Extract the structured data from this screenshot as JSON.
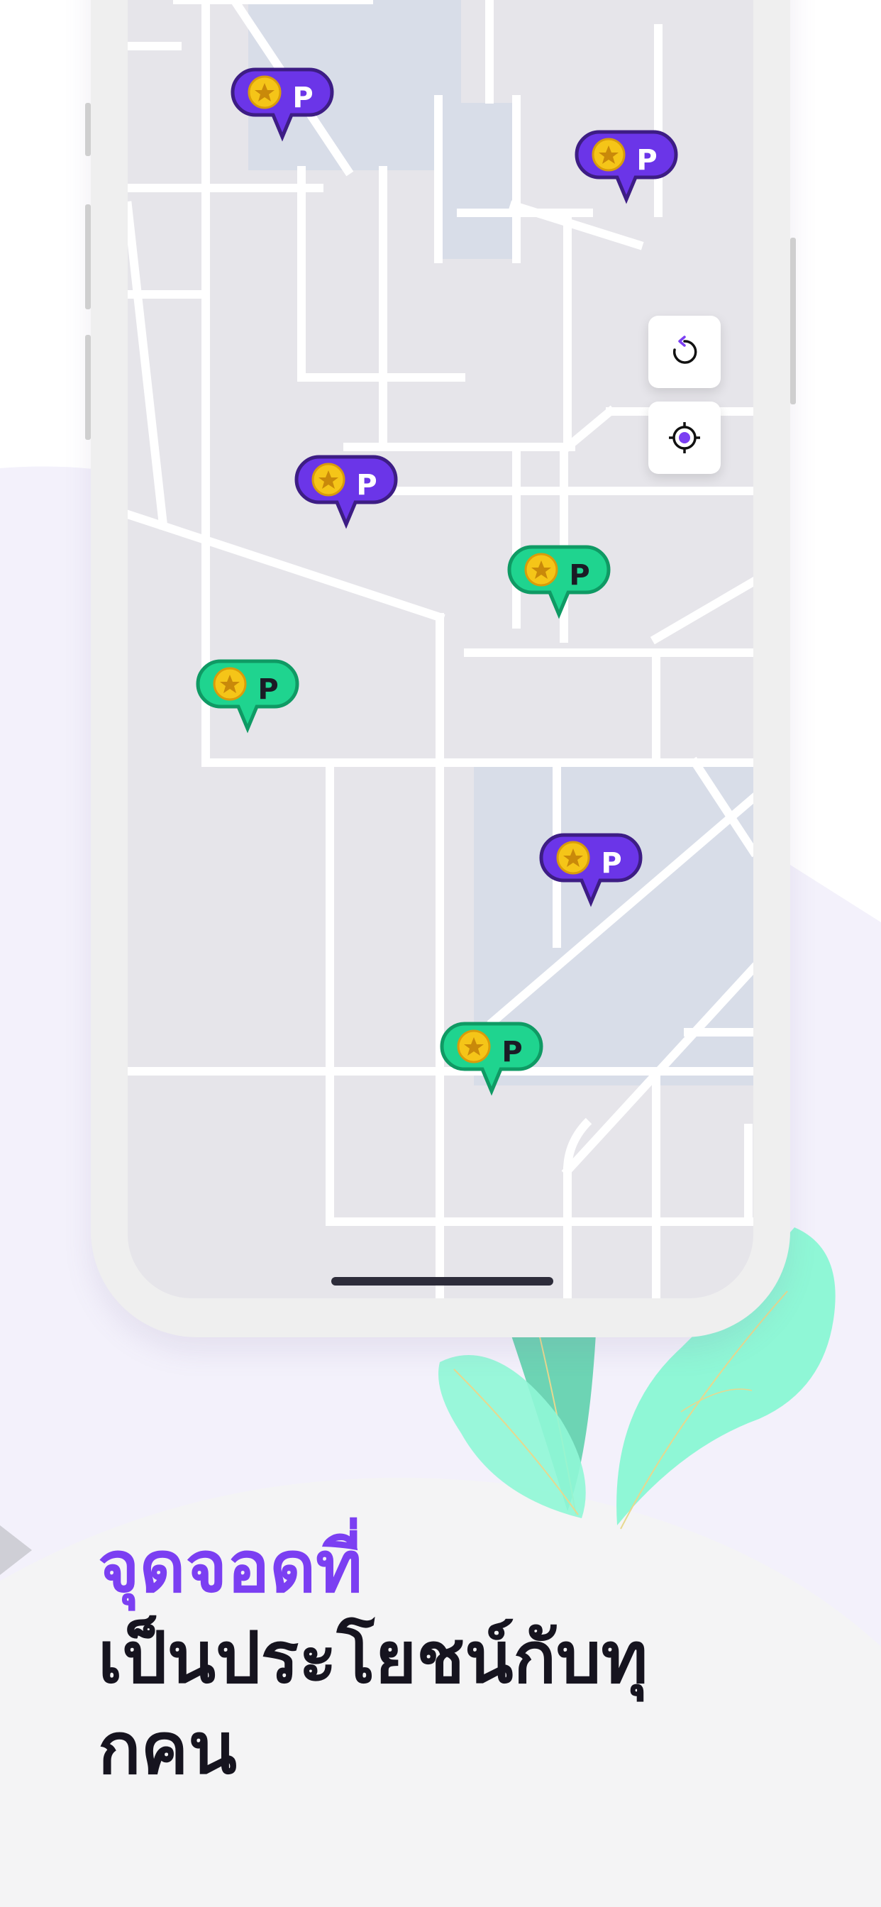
{
  "headline": {
    "line1": "จุดจอดที่",
    "line2": "เป็นประโยชน์กับทุ",
    "line3": "กคน"
  },
  "map": {
    "controls": [
      {
        "icon": "refresh-icon"
      },
      {
        "icon": "my-location-icon"
      }
    ],
    "pins": [
      {
        "letter": "P",
        "style": "purple",
        "icon": "coin-star-icon"
      },
      {
        "letter": "P",
        "style": "purple",
        "icon": "coin-star-icon"
      },
      {
        "letter": "P",
        "style": "purple",
        "icon": "coin-star-icon"
      },
      {
        "letter": "P",
        "style": "green",
        "icon": "coin-star-icon"
      },
      {
        "letter": "P",
        "style": "green",
        "icon": "coin-star-icon"
      },
      {
        "letter": "P",
        "style": "purple",
        "icon": "coin-star-icon"
      },
      {
        "letter": "P",
        "style": "green",
        "icon": "coin-star-icon"
      }
    ]
  },
  "colors": {
    "accent_purple": "#7b3ff2",
    "pin_purple": "#6b35e8",
    "pin_purple_border": "#3d1d84",
    "pin_green": "#1fd48f",
    "pin_green_border": "#0f9a64",
    "coin_gold": "#f5c518",
    "leaf_mint": "#8ff7d6",
    "leaf_teal": "#6dd4b4",
    "text_dark": "#16141f"
  }
}
